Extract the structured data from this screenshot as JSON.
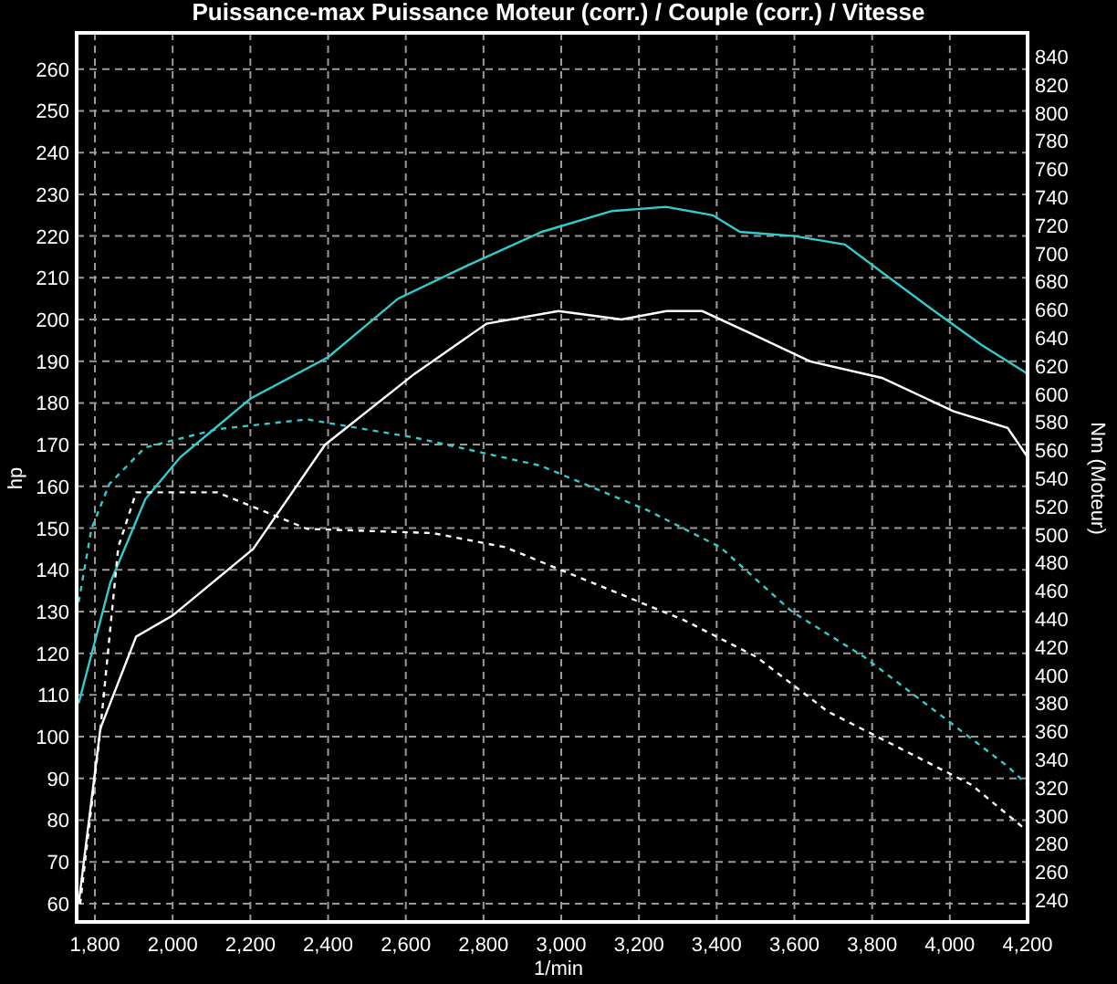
{
  "chart_data": {
    "type": "line",
    "title": "Puissance-max Puissance Moteur (corr.) / Couple (corr.) / Vitesse",
    "xlabel": "1/min",
    "ylabel": "hp",
    "y2label": "Nm (Moteur)",
    "grid": true,
    "xlim": [
      1753,
      4200
    ],
    "ylim": [
      55.6,
      268.7
    ],
    "y2lim": [
      224.4,
      856.9
    ],
    "xticks": [
      {
        "value": 1800,
        "label": "1,800"
      },
      {
        "value": 2000,
        "label": "2,000"
      },
      {
        "value": 2200,
        "label": "2,200"
      },
      {
        "value": 2400,
        "label": "2,400"
      },
      {
        "value": 2600,
        "label": "2,600"
      },
      {
        "value": 2800,
        "label": "2,800"
      },
      {
        "value": 3000,
        "label": "3,000"
      },
      {
        "value": 3200,
        "label": "3,200"
      },
      {
        "value": 3400,
        "label": "3,400"
      },
      {
        "value": 3600,
        "label": "3,600"
      },
      {
        "value": 3800,
        "label": "3,800"
      },
      {
        "value": 4000,
        "label": "4,000"
      },
      {
        "value": 4200,
        "label": "4,200"
      }
    ],
    "yticks": [
      60,
      70,
      80,
      90,
      100,
      110,
      120,
      130,
      140,
      150,
      160,
      170,
      180,
      190,
      200,
      210,
      220,
      230,
      240,
      250,
      260
    ],
    "y2ticks": [
      240,
      260,
      280,
      300,
      320,
      340,
      360,
      380,
      400,
      420,
      440,
      460,
      480,
      500,
      520,
      540,
      560,
      580,
      600,
      620,
      640,
      660,
      680,
      700,
      720,
      740,
      760,
      780,
      800,
      820,
      840
    ],
    "series": [
      {
        "color": "#33cccc",
        "line_style": "solid",
        "x": [
          1758,
          1840,
          1930,
          2020,
          2200,
          2400,
          2580,
          2760,
          2950,
          3130,
          3270,
          3390,
          3460,
          3600,
          3730,
          3830,
          3960,
          4080,
          4200
        ],
        "values": [
          108,
          137,
          157,
          167,
          181,
          191,
          205,
          213,
          221,
          226,
          227,
          225,
          221,
          220,
          218,
          211,
          202,
          194,
          187
        ]
      },
      {
        "color": "#ffffff",
        "line_style": "solid",
        "x": [
          1758,
          1814,
          1906,
          1999,
          2207,
          2392,
          2623,
          2808,
          2993,
          3155,
          3271,
          3363,
          3502,
          3640,
          3825,
          4010,
          4149,
          4200
        ],
        "values": [
          60,
          102,
          124,
          129,
          145,
          170,
          187,
          199,
          202,
          200,
          202,
          202,
          196,
          190,
          186,
          178,
          174,
          167
        ]
      },
      {
        "color": "#33cccc",
        "axis": "y2",
        "line_style": "dashed",
        "x": [
          1758,
          1791,
          1837,
          1929,
          2114,
          2346,
          2623,
          2947,
          3224,
          3409,
          3594,
          3779,
          3964,
          4149,
          4200
        ],
        "values": [
          452,
          504,
          536,
          562,
          575,
          582,
          569,
          549,
          517,
          491,
          445,
          413,
          374,
          335,
          322
        ]
      },
      {
        "color": "#ffffff",
        "axis": "y2",
        "line_style": "dashed",
        "x": [
          1762,
          1814,
          1860,
          1906,
          2114,
          2346,
          2670,
          2855,
          3086,
          3317,
          3502,
          3686,
          3871,
          4056,
          4200
        ],
        "values": [
          237,
          361,
          491,
          530,
          530,
          504,
          501,
          491,
          465,
          439,
          413,
          374,
          348,
          322,
          289
        ]
      }
    ]
  }
}
